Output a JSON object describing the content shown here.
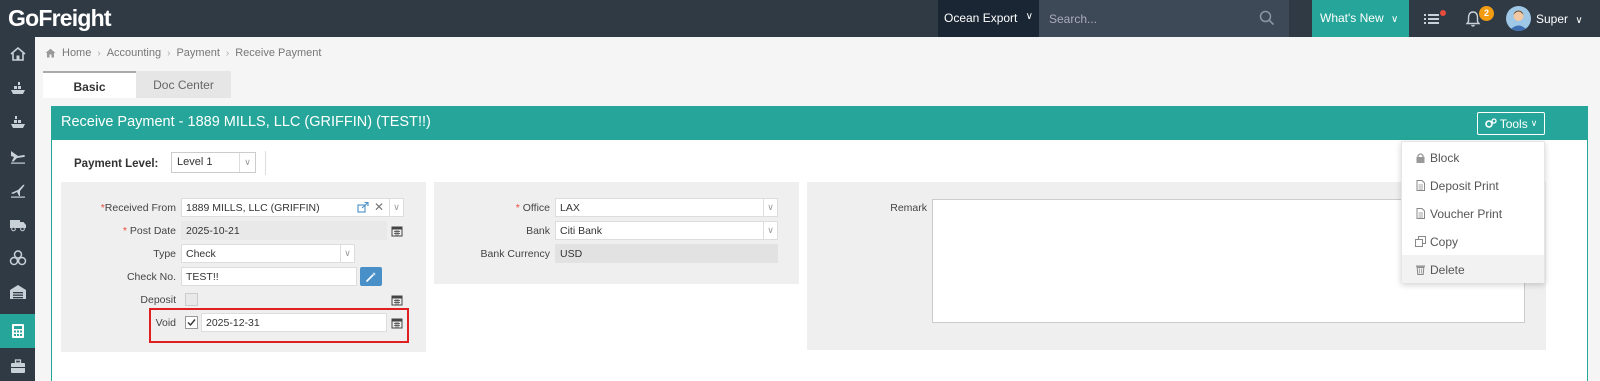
{
  "app": {
    "logo": "GoFreight",
    "brand_color": "#26a69a",
    "nav_color": "#2f3a45"
  },
  "topbar": {
    "mode": "Ocean Export",
    "search_placeholder": "Search...",
    "whats_new": "What's New",
    "notification_count": "2",
    "user_name": "Super"
  },
  "sidebar": {
    "items": [
      {
        "icon": "home-icon"
      },
      {
        "icon": "ocean-import-icon"
      },
      {
        "icon": "ocean-export-icon"
      },
      {
        "icon": "air-import-icon"
      },
      {
        "icon": "air-export-icon"
      },
      {
        "icon": "truck-icon"
      },
      {
        "icon": "misc-icon"
      },
      {
        "icon": "warehouse-icon"
      },
      {
        "icon": "calculator-icon",
        "active": true
      },
      {
        "icon": "briefcase-icon"
      }
    ]
  },
  "breadcrumb": [
    "Home",
    "Accounting",
    "Payment",
    "Receive Payment"
  ],
  "tabs": {
    "basic": "Basic",
    "doc_center": "Doc Center"
  },
  "panel": {
    "title": "Receive Payment - 1889 MILLS, LLC (GRIFFIN) (TEST!!)",
    "tools_label": "Tools",
    "payment_level_label": "Payment Level:",
    "payment_level_value": "Level 1"
  },
  "form": {
    "received_from_label": "Received From",
    "received_from_value": "1889 MILLS, LLC (GRIFFIN)",
    "post_date_label": "Post Date",
    "post_date_value": "2025-10-21",
    "type_label": "Type",
    "type_value": "Check",
    "check_no_label": "Check No.",
    "check_no_value": "TEST!!",
    "deposit_label": "Deposit",
    "deposit_checked": false,
    "void_label": "Void",
    "void_checked": true,
    "void_date": "2025-12-31",
    "office_label": "Office",
    "office_value": "LAX",
    "bank_label": "Bank",
    "bank_value": "Citi Bank",
    "bank_currency_label": "Bank Currency",
    "bank_currency_value": "USD",
    "remark_label": "Remark",
    "remark_value": ""
  },
  "tools_menu": {
    "items": [
      {
        "label": "Block",
        "icon": "lock-icon"
      },
      {
        "label": "Deposit Print",
        "icon": "document-icon"
      },
      {
        "label": "Voucher Print",
        "icon": "document-icon"
      },
      {
        "label": "Copy",
        "icon": "copy-icon"
      },
      {
        "label": "Delete",
        "icon": "trash-icon"
      }
    ]
  }
}
